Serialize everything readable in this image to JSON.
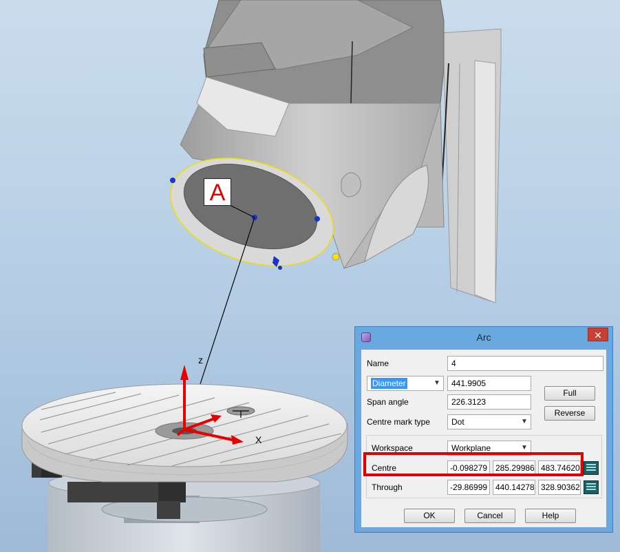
{
  "viewport": {
    "callout_label": "A",
    "axis_z_label": "z",
    "axis_x_label": "X"
  },
  "dialog": {
    "title": "Arc",
    "close_label": "✕",
    "name_label": "Name",
    "name_value": "4",
    "size_mode": "Diameter",
    "size_value": "441.9905",
    "span_angle_label": "Span angle",
    "span_angle_value": "226.3123",
    "centre_mark_type_label": "Centre mark type",
    "centre_mark_type_value": "Dot",
    "full_button": "Full",
    "reverse_button": "Reverse",
    "workspace_label": "Workspace",
    "workspace_value": "Workplane",
    "centre_label": "Centre",
    "centre_values": [
      "-0.098279",
      "285.29986",
      "483.74620"
    ],
    "through_label": "Through",
    "through_values": [
      "-29.86999",
      "440.14278",
      "328.90362"
    ],
    "ok_button": "OK",
    "cancel_button": "Cancel",
    "help_button": "Help"
  },
  "colors": {
    "accent_highlight": "#e10000",
    "arc_curve": "#f0e000",
    "axis_red": "#e60000",
    "handle_blue": "#1a35c8"
  }
}
